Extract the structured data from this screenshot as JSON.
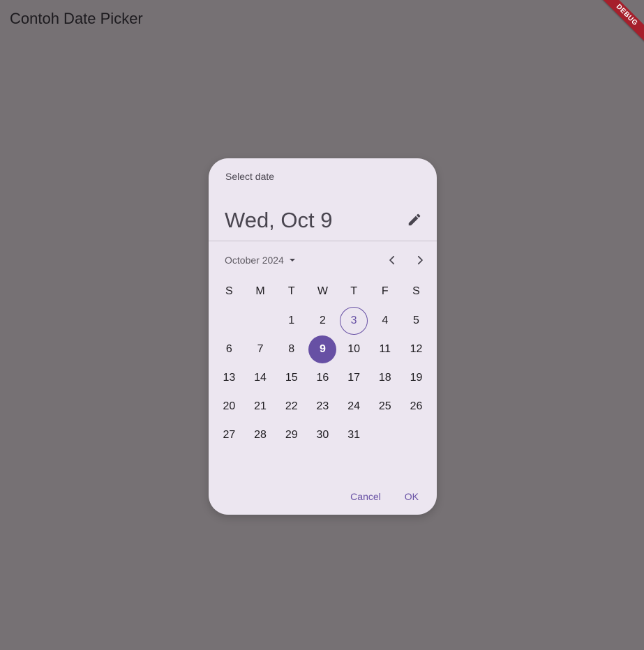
{
  "app": {
    "title": "Contoh Date Picker",
    "debug_banner": "DEBUG"
  },
  "date_picker": {
    "header_label": "Select date",
    "selected_date_text": "Wed, Oct 9",
    "month_year_label": "October 2024",
    "weekdays": [
      "S",
      "M",
      "T",
      "W",
      "T",
      "F",
      "S"
    ],
    "days": [
      "",
      "",
      "1",
      "2",
      "3",
      "4",
      "5",
      "6",
      "7",
      "8",
      "9",
      "10",
      "11",
      "12",
      "13",
      "14",
      "15",
      "16",
      "17",
      "18",
      "19",
      "20",
      "21",
      "22",
      "23",
      "24",
      "25",
      "26",
      "27",
      "28",
      "29",
      "30",
      "31",
      "",
      ""
    ],
    "today_day": "3",
    "selected_day": "9",
    "cancel_label": "Cancel",
    "ok_label": "OK",
    "icons": {
      "edit": "pencil-icon",
      "dropdown": "caret-down-icon",
      "prev": "chevron-left-icon",
      "next": "chevron-right-icon"
    },
    "colors": {
      "accent": "#6750a4",
      "surface": "#ece6f0",
      "scrim": "#767174"
    }
  }
}
